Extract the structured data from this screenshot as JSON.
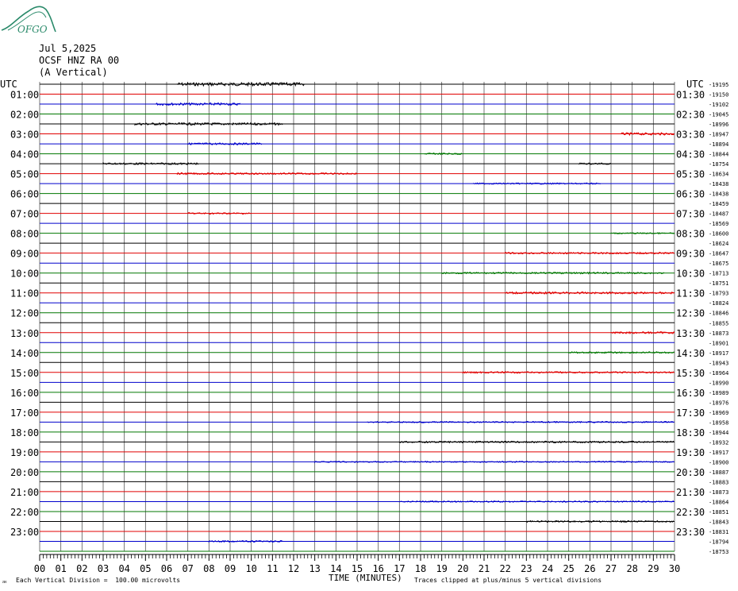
{
  "header": {
    "logo_text": "OFGO",
    "date": "Jul 5,2025",
    "station": "OCSF HNZ RA 00",
    "component": "(A Vertical)"
  },
  "colors": {
    "black": "#000000",
    "red": "#e00000",
    "blue": "#0000cc",
    "green": "#007700",
    "grid": "#555555",
    "logo": "#2a8a6a"
  },
  "chart_data": {
    "type": "line",
    "description_free": true,
    "left_axis_label": "UTC",
    "right_axis_label": "UTC",
    "left_labels": [
      "01:00",
      "02:00",
      "03:00",
      "04:00",
      "05:00",
      "06:00",
      "07:00",
      "08:00",
      "09:00",
      "10:00",
      "11:00",
      "12:00",
      "13:00",
      "14:00",
      "15:00",
      "16:00",
      "17:00",
      "18:00",
      "19:00",
      "20:00",
      "21:00",
      "22:00",
      "23:00"
    ],
    "right_labels": [
      "01:30",
      "02:30",
      "03:30",
      "04:30",
      "05:30",
      "06:30",
      "07:30",
      "08:30",
      "09:30",
      "10:30",
      "11:30",
      "12:30",
      "13:30",
      "14:30",
      "15:30",
      "16:30",
      "17:30",
      "18:30",
      "19:30",
      "20:30",
      "21:30",
      "22:30",
      "23:30"
    ],
    "offsets": [
      -19195,
      -19150,
      -19102,
      -19045,
      -18996,
      -18947,
      -18894,
      -18844,
      -18754,
      -18634,
      -18438,
      -18438,
      -18459,
      -18487,
      -18569,
      -18600,
      -18624,
      -18647,
      -18675,
      -18713,
      -18751,
      -18793,
      -18824,
      -18846,
      -18855,
      -18873,
      -18901,
      -18917,
      -18943,
      -18964,
      -18990,
      -18989,
      -18976,
      -18969,
      -18958,
      -18944,
      -18932,
      -18917,
      -18900,
      -18887,
      -18883,
      -18873,
      -18864,
      -18851,
      -18843,
      -18831,
      -18794,
      -18753
    ],
    "trace_colors": [
      "black",
      "red",
      "blue",
      "green"
    ],
    "x_ticks": [
      "00",
      "01",
      "02",
      "03",
      "04",
      "05",
      "06",
      "07",
      "08",
      "09",
      "10",
      "11",
      "12",
      "13",
      "14",
      "15",
      "16",
      "17",
      "18",
      "19",
      "20",
      "21",
      "22",
      "23",
      "24",
      "25",
      "26",
      "27",
      "28",
      "29",
      "30"
    ],
    "xlabel": "TIME (MINUTES)",
    "xlim": [
      0,
      30
    ],
    "activity": [
      {
        "line": 0,
        "segments": [
          [
            6.5,
            12.5,
            2
          ]
        ]
      },
      {
        "line": 1,
        "segments": []
      },
      {
        "line": 2,
        "segments": [
          [
            5.5,
            9.5,
            1.5
          ]
        ]
      },
      {
        "line": 3,
        "segments": []
      },
      {
        "line": 4,
        "segments": [
          [
            4.5,
            11.5,
            1.5
          ]
        ]
      },
      {
        "line": 5,
        "segments": [
          [
            27.5,
            30,
            1.5
          ]
        ]
      },
      {
        "line": 6,
        "segments": [
          [
            7,
            10.5,
            1.2
          ]
        ]
      },
      {
        "line": 7,
        "segments": [
          [
            18.2,
            20,
            1
          ]
        ]
      },
      {
        "line": 8,
        "segments": [
          [
            3,
            7.5,
            1.2
          ],
          [
            25.5,
            27,
            1
          ]
        ]
      },
      {
        "line": 9,
        "segments": [
          [
            6.5,
            7,
            1.2
          ],
          [
            7,
            15,
            1
          ]
        ]
      },
      {
        "line": 10,
        "segments": [
          [
            20.5,
            26.5,
            0.8
          ]
        ]
      },
      {
        "line": 13,
        "segments": [
          [
            7,
            10,
            1
          ]
        ]
      },
      {
        "line": 15,
        "segments": [
          [
            27,
            30,
            0.8
          ]
        ]
      },
      {
        "line": 17,
        "segments": [
          [
            22,
            30,
            1
          ]
        ]
      },
      {
        "line": 19,
        "segments": [
          [
            19,
            29.5,
            1
          ]
        ]
      },
      {
        "line": 21,
        "segments": [
          [
            22,
            30,
            1.2
          ]
        ]
      },
      {
        "line": 25,
        "segments": [
          [
            27,
            30,
            1.2
          ]
        ]
      },
      {
        "line": 27,
        "segments": [
          [
            25,
            30,
            1
          ]
        ]
      },
      {
        "line": 29,
        "segments": [
          [
            20,
            30,
            1
          ]
        ]
      },
      {
        "line": 34,
        "segments": [
          [
            15.5,
            30,
            0.8
          ]
        ]
      },
      {
        "line": 36,
        "segments": [
          [
            17,
            30,
            1
          ]
        ]
      },
      {
        "line": 38,
        "segments": [
          [
            13,
            30,
            0.7
          ]
        ]
      },
      {
        "line": 42,
        "segments": [
          [
            17,
            30,
            0.8
          ]
        ]
      },
      {
        "line": 44,
        "segments": [
          [
            23,
            30,
            1
          ]
        ]
      },
      {
        "line": 46,
        "segments": [
          [
            8,
            11.5,
            1
          ]
        ]
      }
    ]
  },
  "footer": {
    "division_note": "Each Vertical Division =  100.00 microvolts",
    "clip_note": "Traces clipped at plus/minus 5 vertical divisions",
    "corner_mark": "ᴊᴎ"
  }
}
